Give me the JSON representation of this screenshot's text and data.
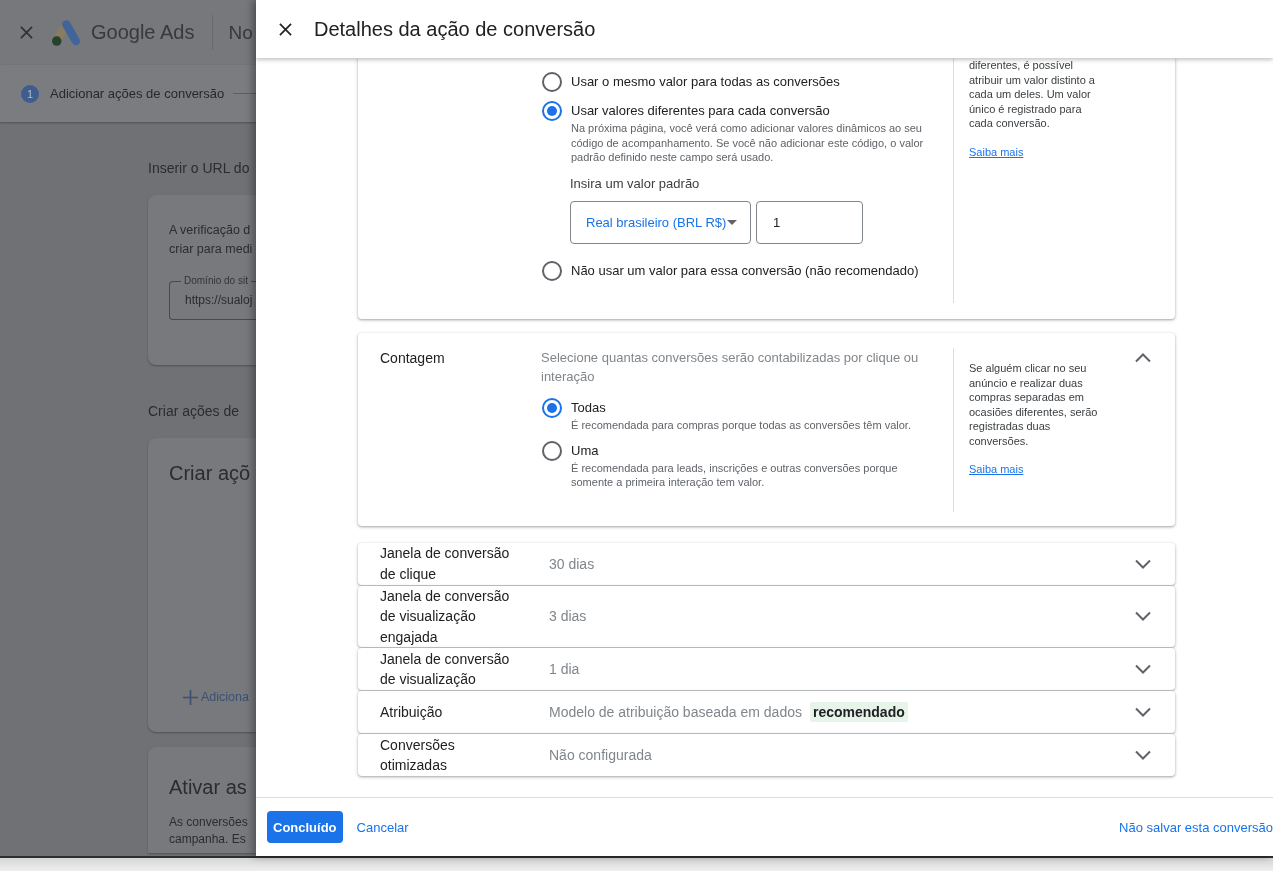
{
  "background_page": {
    "header": {
      "app_name": "Google Ads",
      "page_title": "No"
    },
    "stepper": [
      {
        "number": "1",
        "label": "Adicionar ações de conversão",
        "selected": true
      }
    ],
    "url_heading": "Inserir o URL do",
    "url_card": {
      "text": "A verificação d\ncriar para medi",
      "field": {
        "label": "Domínio do sit",
        "value": "https://sualoj"
      }
    },
    "create_heading": "Criar ações de",
    "create_card": {
      "title": "Criar açõ",
      "add_link": "Adiciona"
    },
    "activate_card": {
      "title": "Ativar as",
      "text": "As conversões\ncampanha. Es"
    }
  },
  "dialog": {
    "title": "Detalhes da ação de conversão",
    "value_section": {
      "options": [
        {
          "label": "Usar o mesmo valor para todas as conversões",
          "selected": false
        },
        {
          "label": "Usar valores diferentes para cada conversão",
          "selected": true,
          "help": "Na próxima página, você verá como adicionar valores dinâmicos ao seu código de acompanhamento. Se você não adicionar este código, o valor padrão definido neste campo será usado.",
          "default_value": {
            "label": "Insira um valor padrão",
            "currency": "Real brasileiro (BRL R$)",
            "value": "1"
          }
        },
        {
          "label": "Não usar um valor para essa conversão (não recomendado)",
          "selected": false
        }
      ],
      "help_text": "diferentes, é possível atribuir um valor distinto a cada um deles. Um valor único é registrado para cada conversão.",
      "help_link": "Saiba mais"
    },
    "counting": {
      "title": "Contagem",
      "expanded": true,
      "description": "Selecione quantas conversões serão contabilizadas por clique ou interação",
      "options": [
        {
          "label": "Todas",
          "help": "É recomendada para compras porque todas as conversões têm valor.",
          "selected": true
        },
        {
          "label": "Uma",
          "help": "É recomendada para leads, inscrições e outras conversões porque somente a primeira interação tem valor.",
          "selected": false
        }
      ],
      "help_text": "Se alguém clicar no seu anúncio e realizar duas compras separadas em ocasiões diferentes, serão registradas duas conversões.",
      "help_link": "Saiba mais"
    },
    "settings": [
      {
        "label": "Janela de conversão de clique",
        "value": "30 dias",
        "expanded": false
      },
      {
        "label": "Janela de conversão de visualização engajada",
        "value": "3 dias",
        "expanded": false
      },
      {
        "label": "Janela de conversão de visualização",
        "value": "1 dia",
        "expanded": false
      },
      {
        "label": "Atribuição",
        "value": "Modelo de atribuição baseada em dados",
        "badge": "recomendado",
        "expanded": false
      },
      {
        "label": "Conversões otimizadas",
        "value": "Não configurada",
        "expanded": false
      }
    ],
    "footer": {
      "done_button": "Concluído",
      "cancel_link": "Cancelar",
      "discard_link": "Não salvar esta conversão"
    }
  }
}
